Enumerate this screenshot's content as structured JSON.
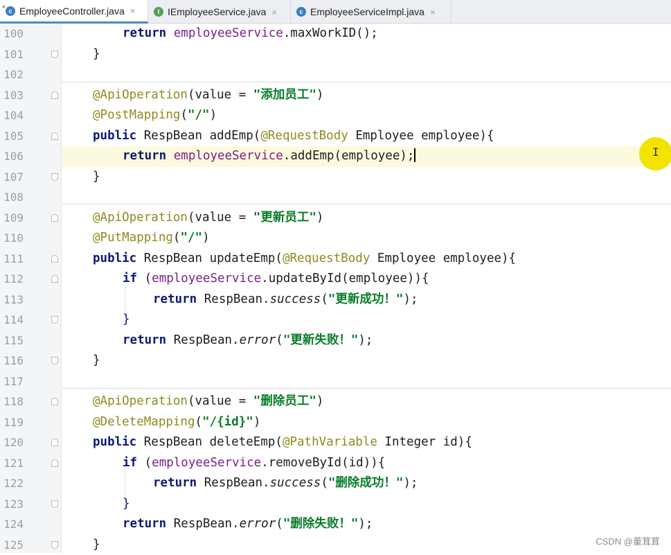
{
  "tabs": [
    {
      "label": "EmployeeController.java",
      "icon": "class-icon",
      "modified": "*",
      "active": true
    },
    {
      "label": "IEmployeeService.java",
      "icon": "interface-icon",
      "active": false
    },
    {
      "label": "EmployeeServiceImpl.java",
      "icon": "class-icon",
      "active": false
    }
  ],
  "tab_close_glyph": "×",
  "editor": {
    "lines": [
      {
        "num": "100"
      },
      {
        "num": "101"
      },
      {
        "num": "102"
      },
      {
        "num": "103"
      },
      {
        "num": "104"
      },
      {
        "num": "105"
      },
      {
        "num": "106"
      },
      {
        "num": "107"
      },
      {
        "num": "108"
      },
      {
        "num": "109"
      },
      {
        "num": "110"
      },
      {
        "num": "111"
      },
      {
        "num": "112"
      },
      {
        "num": "113"
      },
      {
        "num": "114"
      },
      {
        "num": "115"
      },
      {
        "num": "116"
      },
      {
        "num": "117"
      },
      {
        "num": "118"
      },
      {
        "num": "119"
      },
      {
        "num": "120"
      },
      {
        "num": "121"
      },
      {
        "num": "122"
      },
      {
        "num": "123"
      },
      {
        "num": "124"
      },
      {
        "num": "125"
      }
    ],
    "current_line": "106",
    "tokens": {
      "kw_return": "return",
      "kw_public": "public",
      "kw_if": "if",
      "employeeService": "employeeService",
      "maxWorkID_call": ".maxWorkID();",
      "brace_close": "}",
      "ann_api": "@ApiOperation",
      "value_eq": "(value = ",
      "str_add": "\"添加员工\"",
      "str_update": "\"更新员工\"",
      "str_delete": "\"删除员工\"",
      "paren_close": ")",
      "ann_post": "@PostMapping",
      "ann_put": "@PutMapping",
      "ann_delete": "@DeleteMapping",
      "str_slash": "\"/\"",
      "str_id": "\"/{id}\"",
      "paren_open": "(",
      "respbean_addEmp": " RespBean addEmp(",
      "respbean_updateEmp": " RespBean updateEmp(",
      "respbean_deleteEmp": " RespBean deleteEmp(",
      "ann_requestbody": "@RequestBody",
      "ann_pathvariable": "@PathVariable",
      "employee_param": " Employee employee){",
      "integer_param": " Integer id){",
      "addEmp_call": ".addEmp(employee);",
      "if_open": " (",
      "updateById_call": ".updateById(employee)){",
      "removeById_call": ".removeById(id)){",
      "respbean_dot": " RespBean.",
      "success": "success",
      "error": "error",
      "str_update_ok": "\"更新成功！\"",
      "str_update_fail": "\"更新失败！\"",
      "str_delete_ok": "\"删除成功！\"",
      "str_delete_fail": "\"删除失败！\"",
      "close_semi": ");"
    }
  },
  "cursor_glyph": "I",
  "watermark": "CSDN @董茸茸",
  "colors": {
    "keyword": "#0d1a7a",
    "annotation": "#8f8a1d",
    "field": "#7a1f8c",
    "string": "#087c27",
    "current_line": "#fcfadd",
    "cursor_highlight": "#f2e300"
  }
}
